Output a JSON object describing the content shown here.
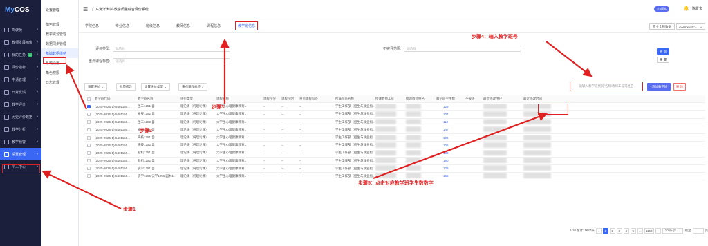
{
  "app": {
    "logo_my": "My",
    "logo_cos": "COS",
    "title": "广东海洋大学-教学质量综合评价系统",
    "version_badge": "5.0版本",
    "user": "陈爱文"
  },
  "sidebar": {
    "items": [
      {
        "label": "驾驶舱",
        "icon": "dashboard-icon"
      },
      {
        "label": "教师发展画像",
        "icon": "user-icon"
      },
      {
        "label": "我的任务",
        "icon": "task-icon",
        "badge": "0"
      },
      {
        "label": "评价指标",
        "icon": "chart-icon"
      },
      {
        "label": "申请管理",
        "icon": "apply-icon"
      },
      {
        "label": "日常反馈",
        "icon": "feedback-icon"
      },
      {
        "label": "教学评价",
        "icon": "eval-icon"
      },
      {
        "label": "历史评价数据",
        "icon": "history-icon"
      },
      {
        "label": "教学分析",
        "icon": "analysis-icon"
      },
      {
        "label": "教学预警",
        "icon": "warning-icon"
      },
      {
        "label": "设置管理",
        "icon": "settings-icon",
        "active": true
      },
      {
        "label": "个人中心",
        "icon": "person-icon"
      }
    ]
  },
  "submenu": {
    "head": "设置管理",
    "items": [
      "角色管理",
      "教学资源管理",
      "数据同步管理",
      "基础数据维护",
      "系统设置",
      "角色权限",
      "日志管理"
    ],
    "active_index": 3
  },
  "tabs": {
    "items": [
      "学院信息",
      "专业信息",
      "班级信息",
      "教师信息",
      "课程信息",
      "教学班信息"
    ],
    "active_index": 5,
    "institution_btn": "专业全称数据",
    "year": "2025-2026-1"
  },
  "filter": {
    "eval_type_label": "评价类型:",
    "eval_type_placeholder": "请选择",
    "key_course_label": "重点课程标签:",
    "key_course_placeholder": "请选择",
    "no_eval_label": "不被评范围:",
    "no_eval_placeholder": "请选择",
    "query": "查 询",
    "reset": "重 置"
  },
  "toolbar": {
    "btn1": "设置评价 ⌄",
    "btn2": "批量修改",
    "btn3": "设置评价类型 ⌄",
    "btn4": "重点课程标签 ⌄",
    "search_placeholder": "请输入教学班代码/名称/教师工号或姓名",
    "add": "+添加教学班",
    "del": "删 除"
  },
  "table": {
    "headers": [
      "教学班代码",
      "教学班名称",
      "评价类型",
      "课程名称",
      "课程学分",
      "课程学时",
      "重点课程标签",
      "所属院系名称",
      "授课教师工号",
      "授课教师姓名",
      "教学班学生数",
      "不被评",
      "最近修改用户",
      "最近修改时间"
    ],
    "rows": [
      {
        "code": "(2025-2026-1)-5401150...",
        "name": "生工1251.自",
        "type": "理论课（纯理论课）",
        "course": "大学生心理健康教育1",
        "c1": "--",
        "c2": "--",
        "c3": "--",
        "dept": "学生工作部（招生与就业指...",
        "count": "129",
        "checked": true
      },
      {
        "code": "(2025-2026-1)-5401150...",
        "name": "食安1252.自",
        "type": "理论课（纯理论课）",
        "course": "大学生心理健康教育1",
        "c1": "--",
        "c2": "--",
        "c3": "--",
        "dept": "学生工作部（招生与就业指...",
        "count": "107",
        "checked": false
      },
      {
        "code": "(2025-2026-1)-5401150...",
        "name": "生工1252.自",
        "type": "理论课（纯理论课）",
        "course": "大学生心理健康教育1",
        "c1": "--",
        "c2": "--",
        "c3": "--",
        "dept": "学生工作部（招生与就业指...",
        "count": "112",
        "checked": false
      },
      {
        "code": "(2025-2026-1)-5401150...",
        "name": "食安1251.自",
        "type": "理论课（纯理论课）",
        "course": "大学生心理健康教育1",
        "c1": "--",
        "c2": "--",
        "c3": "--",
        "dept": "学生工作部（招生与就业指...",
        "count": "147",
        "checked": false
      },
      {
        "code": "(2025-2026-1)-5401150...",
        "name": "海技1251.自",
        "type": "理论课（纯理论课）",
        "course": "大学生心理健康教育1",
        "c1": "--",
        "c2": "--",
        "c3": "--",
        "dept": "学生工作部（招生与就业指...",
        "count": "106",
        "checked": false
      },
      {
        "code": "(2025-2026-1)-5401150...",
        "name": "海技1252.自",
        "type": "理论课（纯理论课）",
        "course": "大学生心理健康教育1",
        "c1": "--",
        "c2": "--",
        "c3": "--",
        "dept": "学生工作部（招生与就业指...",
        "count": "106",
        "checked": false
      },
      {
        "code": "(2025-2026-1)-5401150...",
        "name": "船机1251.自",
        "type": "理论课（纯理论课）",
        "course": "大学生心理健康教育1",
        "c1": "--",
        "c2": "--",
        "c3": "--",
        "dept": "学生工作部（招生与就业指...",
        "count": "138",
        "checked": false
      },
      {
        "code": "(2025-2026-1)-5401150...",
        "name": "船机1252.自",
        "type": "理论课（纯理论课）",
        "course": "大学生心理健康教育1",
        "c1": "--",
        "c2": "--",
        "c3": "--",
        "dept": "学生工作部（招生与就业指...",
        "count": "150",
        "checked": false
      },
      {
        "code": "(2025-2026-1)-5401150...",
        "name": "农学1251.自",
        "type": "理论课（纯理论课）",
        "course": "大学生心理健康教育1",
        "c1": "--",
        "c2": "--",
        "c3": "--",
        "dept": "学生工作部（招生与就业指...",
        "count": "138",
        "checked": false
      },
      {
        "code": "(2025-2026-1)-5401150...",
        "name": "农学1255,农学1256,园林1...",
        "type": "理论课（纯理论课）",
        "course": "大学生心理健康教育1",
        "c1": "--",
        "c2": "--",
        "c3": "--",
        "dept": "学生工作部（招生与就业指...",
        "count": "155",
        "checked": false
      }
    ]
  },
  "pager": {
    "summary": "1-10 总计11627条",
    "pages": [
      "1",
      "2",
      "3",
      "4",
      "5",
      "...",
      "1163"
    ],
    "size": "10 条/页 ⌄",
    "jump": "跳至",
    "page_unit": "页"
  },
  "annotations": {
    "step1": "步骤1",
    "step2": "步骤2",
    "step3": "步骤3",
    "step4": "步骤4：输入教学班号",
    "step5": "步骤5：点击对应教学班学生数数字"
  }
}
